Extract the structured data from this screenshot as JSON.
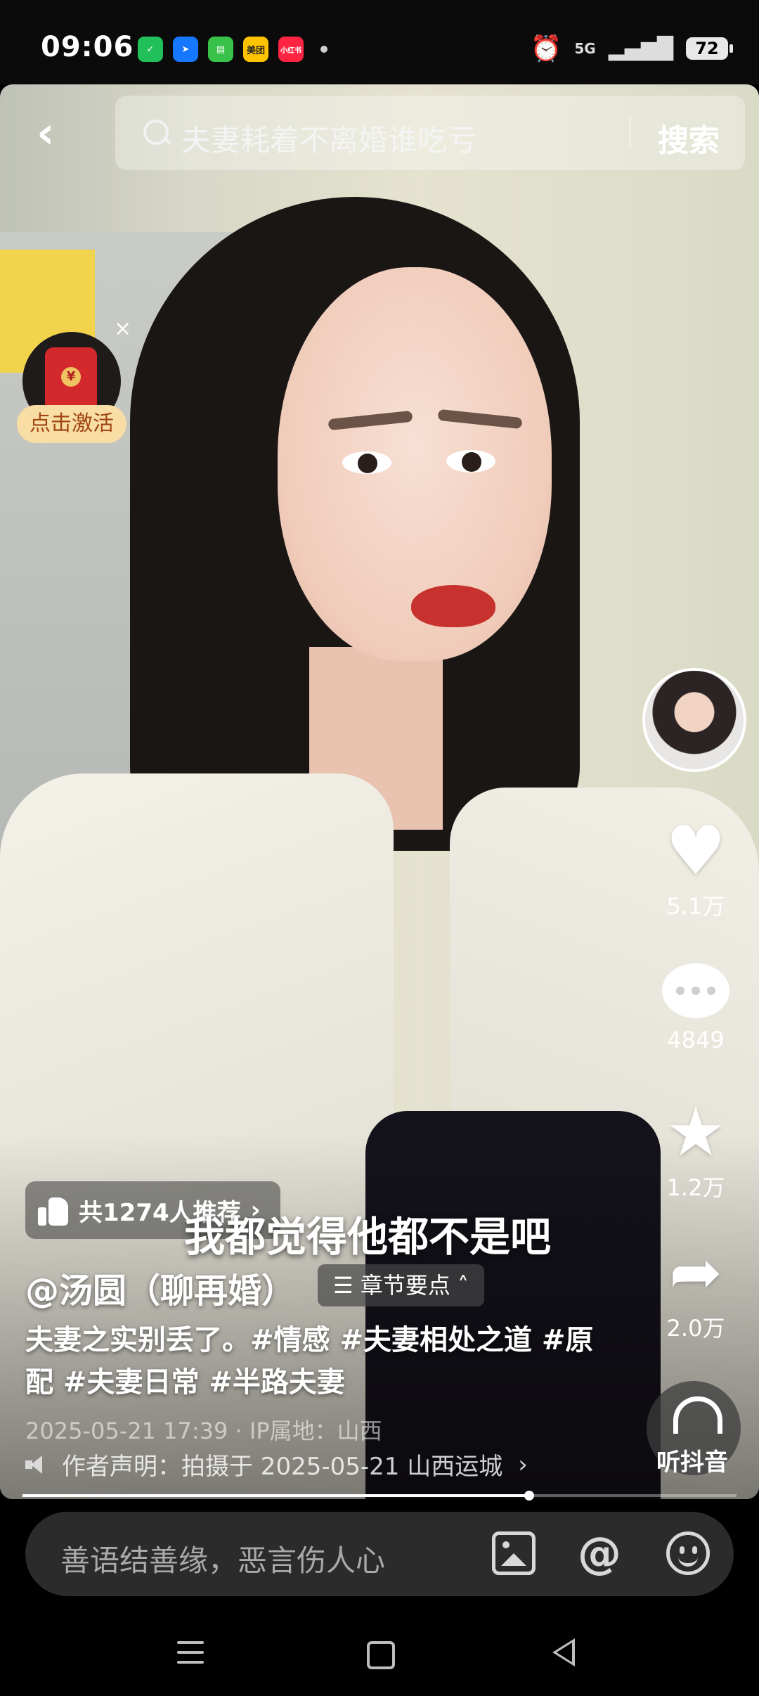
{
  "status_bar": {
    "time": "09:06",
    "network": "5G",
    "battery": "72",
    "notification_apps": [
      {
        "name": "wechat",
        "color": "#21c05a",
        "label": ""
      },
      {
        "name": "dingtalk",
        "color": "#1677ff",
        "label": ""
      },
      {
        "name": "messages",
        "color": "#38c24a",
        "label": ""
      },
      {
        "name": "meituan",
        "color": "#ffc300",
        "label": "美团"
      },
      {
        "name": "xiaohongshu",
        "color": "#ff2442",
        "label": "小红书"
      }
    ]
  },
  "search": {
    "query": "夫妻耗着不离婚谁吃亏",
    "button": "搜索"
  },
  "promo": {
    "activate_label": "点击激活",
    "close": "×"
  },
  "rail": {
    "likes": "5.1万",
    "comments": "4849",
    "favorites": "1.2万",
    "shares": "2.0万",
    "listen_label": "听抖音"
  },
  "video": {
    "recommend": "共1274人推荐",
    "subtitle": "我都觉得他都不是吧",
    "author": "@汤圆（聊再婚）",
    "chapter_label": "章节要点",
    "description": "夫妻之实别丢了。#情感 #夫妻相处之道 #原配 #夫妻日常 #半路夫妻",
    "meta": "2025-05-21 17:39 · IP属地：山西",
    "declaration": "作者声明：拍摄于 2025-05-21 山西运城",
    "progress": 0.71
  },
  "comment_bar": {
    "placeholder": "善语结善缘，恶言伤人心"
  }
}
